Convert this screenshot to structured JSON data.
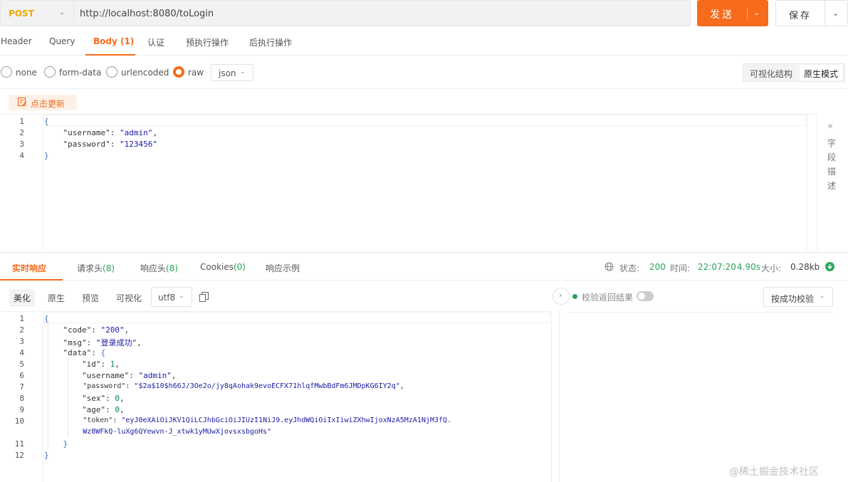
{
  "request": {
    "method": "POST",
    "url": "http://localhost:8080/toLogin",
    "send_label": "发送",
    "save_label": "保存"
  },
  "request_tabs": [
    {
      "label": "Header"
    },
    {
      "label": "Query"
    },
    {
      "label": "Body (1)"
    },
    {
      "label": "认证"
    },
    {
      "label": "预执行操作"
    },
    {
      "label": "后执行操作"
    }
  ],
  "body_types": [
    {
      "label": "none"
    },
    {
      "label": "form-data"
    },
    {
      "label": "urlencoded"
    },
    {
      "label": "raw"
    }
  ],
  "body_format": "json",
  "view_modes": {
    "visual": "可视化结构",
    "raw": "原生模式"
  },
  "refresh_label": "点击更新",
  "request_body": {
    "line_numbers": [
      "1",
      "2",
      "3",
      "4"
    ],
    "brace_open": "{",
    "brace_close": "}",
    "l2_key": "\"username\"",
    "l2_val": "\"admin\"",
    "l3_key": "\"password\"",
    "l3_val": "\"123456\""
  },
  "field_desc": {
    "arrow": "«",
    "chars": [
      "字",
      "段",
      "描",
      "述"
    ]
  },
  "response_tabs": {
    "realtime": "实时响应",
    "req_headers": "请求头",
    "req_headers_count": "(8)",
    "resp_headers": "响应头",
    "resp_headers_count": "(8)",
    "cookies": "Cookies",
    "cookies_count": "(0)",
    "examples": "响应示例"
  },
  "status": {
    "status_label": "状态:",
    "status_code": "200",
    "time_label": "时间:",
    "time_value": "22:07:20",
    "duration": "4.90s",
    "size_label": "大小:",
    "size_value": "0.28kb"
  },
  "response_tools": {
    "pretty": "美化",
    "raw": "原生",
    "preview": "预览",
    "visualize": "可视化",
    "encoding": "utf8"
  },
  "verify": {
    "label": "校验返回结果",
    "mode": "按成功校验"
  },
  "response_body": {
    "line_numbers": [
      "1",
      "2",
      "3",
      "4",
      "5",
      "6",
      "7",
      "8",
      "9",
      "10",
      "",
      "11",
      "12"
    ],
    "code_key": "\"code\"",
    "code_val": "\"200\"",
    "msg_key": "\"msg\"",
    "msg_val": "\"登录成功\"",
    "data_key": "\"data\"",
    "id_key": "\"id\"",
    "id_val": "1",
    "username_key": "\"username\"",
    "username_val": "\"admin\"",
    "password_key": "\"password\"",
    "password_val": "\"$2a$10$h66J/3Oe2o/jy8qAohak9evoECFX71hlqfMwbBdFm6JMDpKG6IY2q\"",
    "sex_key": "\"sex\"",
    "sex_val": "0",
    "age_key": "\"age\"",
    "age_val": "0",
    "token_key": "\"token\"",
    "token_val_1": "\"eyJ0eXAiOiJKV1QiLCJhbGciOiJIUzI1NiJ9.eyJhdWQiOiIxIiwiZXhwIjoxNzA5MzA1NjM3fQ.",
    "token_val_2": "Wz8WFkQ-luXg6QYewvn-J_xtwk1yMUwXjovsxsbgoHs\""
  },
  "watermark": "@稀土掘金技术社区",
  "colors": {
    "accent": "#f76b1c",
    "method": "#f0a800",
    "success": "#2aa55a"
  }
}
